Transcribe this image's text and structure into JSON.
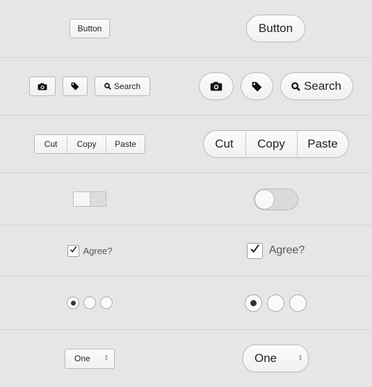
{
  "buttons": {
    "primary_label": "Button"
  },
  "icon_buttons": {
    "camera_icon": "camera-icon",
    "tag_icon": "tag-icon",
    "search_icon": "search-icon",
    "search_label": "Search"
  },
  "segmented": {
    "items": [
      "Cut",
      "Copy",
      "Paste"
    ]
  },
  "toggle": {
    "state": "off"
  },
  "checkbox": {
    "label": "Agree?",
    "checked": true
  },
  "radios": {
    "selected_index": 0,
    "count": 3
  },
  "select": {
    "value": "One"
  },
  "colors": {
    "background": "#e6e6e6",
    "divider": "#d4d4d4",
    "border": "#b9b9b9",
    "text": "#222222"
  }
}
